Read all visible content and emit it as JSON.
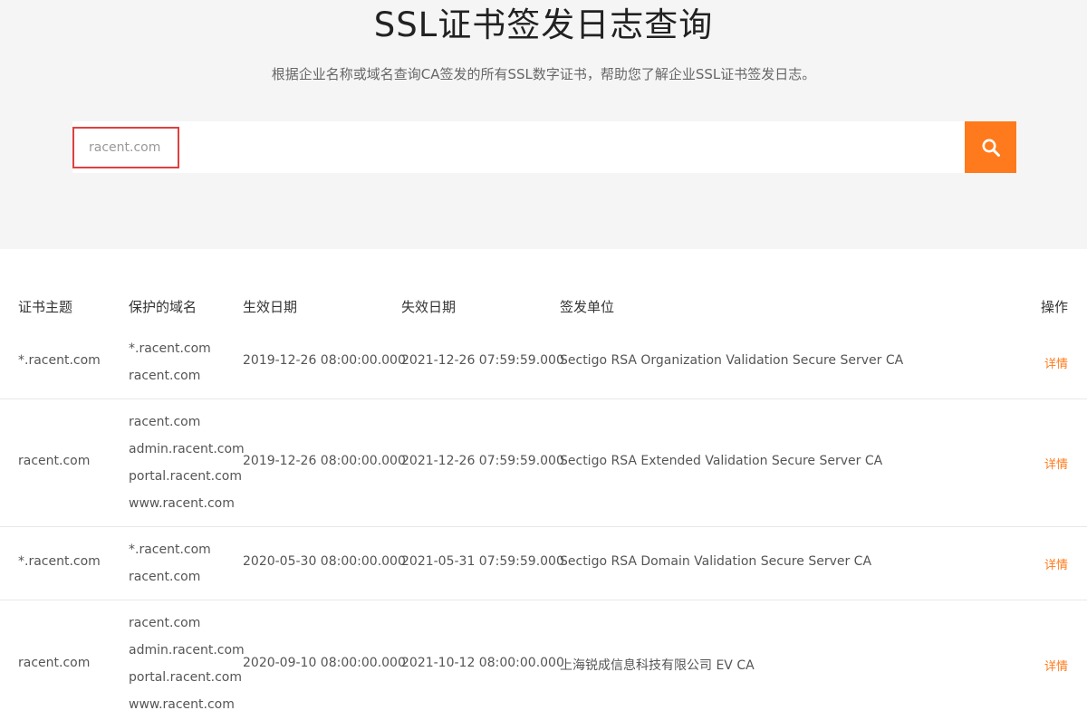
{
  "hero": {
    "title": "SSL证书签发日志查询",
    "subtitle": "根据企业名称或域名查询CA签发的所有SSL数字证书，帮助您了解企业SSL证书签发日志。"
  },
  "search": {
    "value": "racent.com",
    "button_icon": "search-icon",
    "button_color": "#ff7a1c"
  },
  "table": {
    "headers": {
      "subject": "证书主题",
      "domains": "保护的域名",
      "valid_from": "生效日期",
      "valid_to": "失效日期",
      "issuer": "签发单位",
      "action": "操作"
    },
    "rows": [
      {
        "subject": "*.racent.com",
        "domains": [
          "*.racent.com",
          "racent.com"
        ],
        "valid_from": "2019-12-26 08:00:00.000",
        "valid_to": "2021-12-26 07:59:59.000",
        "issuer": "Sectigo RSA Organization Validation Secure Server CA",
        "action": "详情"
      },
      {
        "subject": "racent.com",
        "domains": [
          "racent.com",
          "admin.racent.com",
          "portal.racent.com",
          "www.racent.com"
        ],
        "valid_from": "2019-12-26 08:00:00.000",
        "valid_to": "2021-12-26 07:59:59.000",
        "issuer": "Sectigo RSA Extended Validation Secure Server CA",
        "action": "详情"
      },
      {
        "subject": "*.racent.com",
        "domains": [
          "*.racent.com",
          "racent.com"
        ],
        "valid_from": "2020-05-30 08:00:00.000",
        "valid_to": "2021-05-31 07:59:59.000",
        "issuer": "Sectigo RSA Domain Validation Secure Server CA",
        "action": "详情"
      },
      {
        "subject": "racent.com",
        "domains": [
          "racent.com",
          "admin.racent.com",
          "portal.racent.com",
          "www.racent.com"
        ],
        "valid_from": "2020-09-10 08:00:00.000",
        "valid_to": "2021-10-12 08:00:00.000",
        "issuer": "上海锐成信息科技有限公司 EV CA",
        "action": "详情"
      }
    ]
  }
}
